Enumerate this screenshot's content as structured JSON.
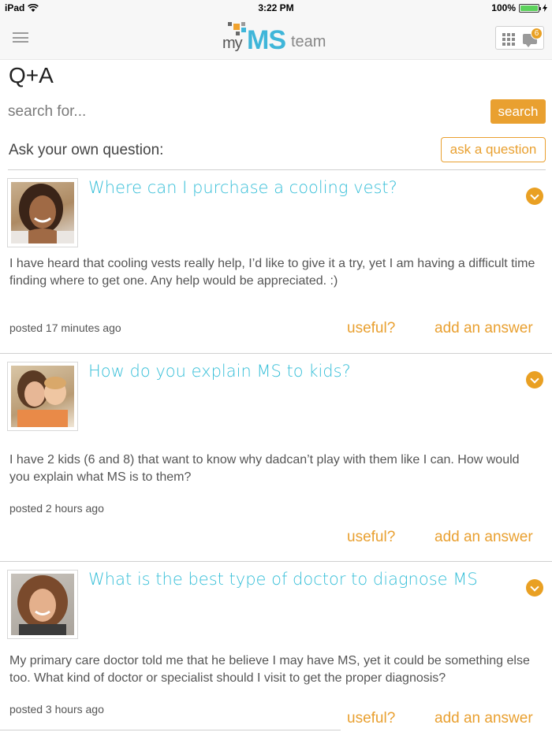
{
  "status_bar": {
    "device": "iPad",
    "time": "3:22 PM",
    "battery": "100%"
  },
  "header": {
    "logo_my": "my",
    "logo_ms": "MS",
    "logo_team": "team",
    "notification_count": "6"
  },
  "page": {
    "title": "Q+A"
  },
  "search": {
    "placeholder": "search for...",
    "button_label": "search"
  },
  "ask": {
    "label": "Ask your own question:",
    "button_label": "ask a question"
  },
  "questions": [
    {
      "title": "Where can I purchase a cooling vest?",
      "body": "I have heard that cooling vests really help, I’d like to give it a try, yet I am having a difficult time finding where to get one.  Any help would be appreciated. :)",
      "posted": "posted 17 minutes ago",
      "useful_label": "useful?",
      "answer_label": "add an answer"
    },
    {
      "title": "How do you explain MS to kids?",
      "body": "I have 2 kids (6 and 8) that want to know why dadcan’t play with them like I can.  How would you explain what MS is to them?",
      "posted": "posted 2 hours ago",
      "useful_label": "useful?",
      "answer_label": "add an answer"
    },
    {
      "title": "What is the best type of doctor to diagnose MS",
      "body": "My primary care doctor told me that he believe I may have MS, yet it could be something else too.  What kind of doctor or specialist should I visit to get the proper diagnosis?",
      "posted": "posted 3 hours ago",
      "useful_label": "useful?",
      "answer_label": "add an answer"
    }
  ],
  "colors": {
    "accent_orange": "#e9a030",
    "link_blue": "#37bfd8",
    "logo_blue": "#3fb6d9"
  }
}
